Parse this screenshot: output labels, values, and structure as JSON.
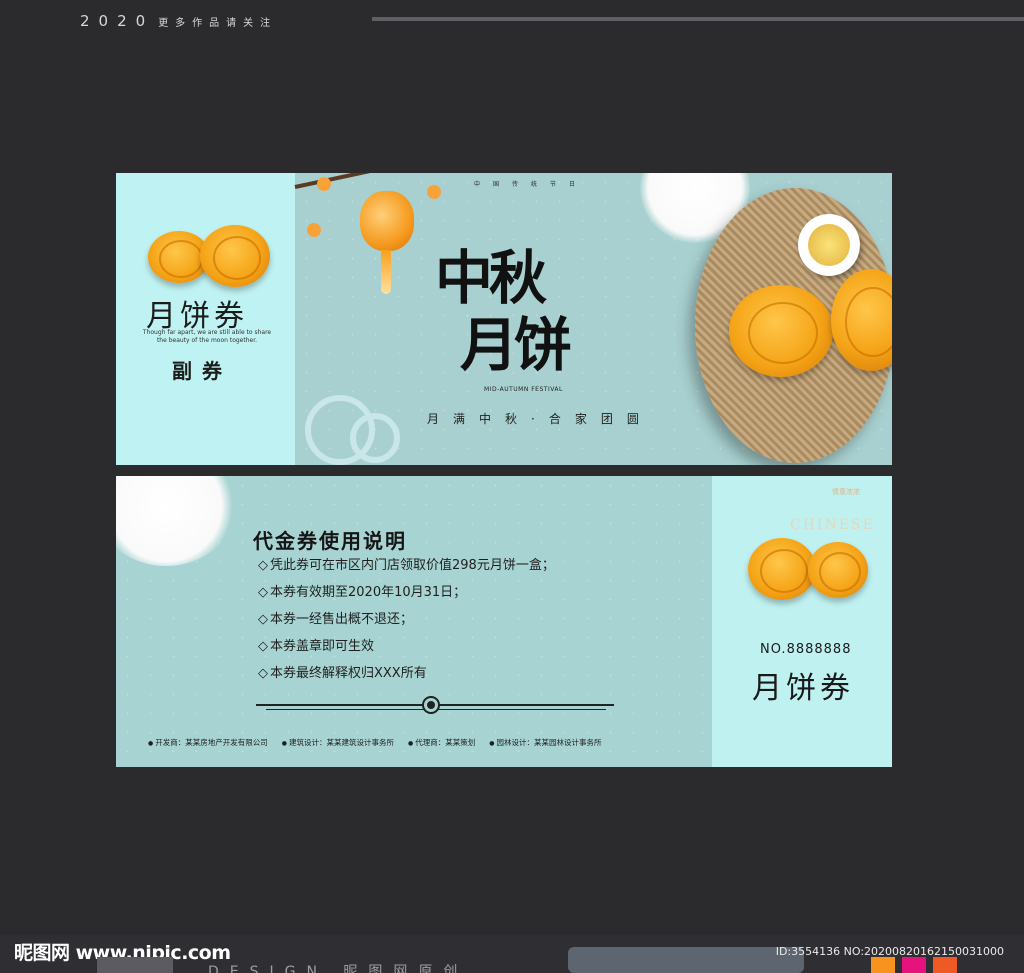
{
  "header": {
    "year": "2020",
    "tagline": "更多作品请关注"
  },
  "ticket_top": {
    "stub": {
      "title": "月饼券",
      "subtitle": "Though far apart, we are still able to share the beauty of the moon together.",
      "label": "副券"
    },
    "main": {
      "top_small": "中国传统节日",
      "calligraphy_line1": "中秋",
      "calligraphy_line2": "月饼",
      "english_caption": "MID-AUTUMN FESTIVAL",
      "slogan": "月满中秋·合家团圆"
    }
  },
  "ticket_bottom": {
    "title": "代金券使用说明",
    "rules": [
      "凭此券可在市区内门店领取价值298元月饼一盒；",
      "本券有效期至2020年10月31日；",
      "本券一经售出概不退还；",
      "本券盖章即可生效",
      "本券最终解释权归XXX所有"
    ],
    "credits": [
      "开发商：某某房地产开发有限公司",
      "建筑设计：某某建筑设计事务所",
      "代理商：某某策划",
      "园林设计：某某园林设计事务所"
    ],
    "stub": {
      "tiny_text": "情意浓浓",
      "ghost_text": "CHINESE",
      "number": "NO.8888888",
      "title": "月饼券"
    }
  },
  "footer": {
    "logo": "昵图网 www.nipic.com",
    "design": "DESIGN 昵图网原创",
    "id_text": "ID:3554136 NO:20200820162150031000"
  },
  "colors": {
    "bg": "#2b2b2d",
    "ticket_teal": "#a8d0d0",
    "stub_teal": "#bff2f2",
    "mooncake": "#f5a417",
    "accent_orange": "#f7931e",
    "accent_pink": "#e6127e",
    "accent_red_orange": "#ef5a24"
  }
}
